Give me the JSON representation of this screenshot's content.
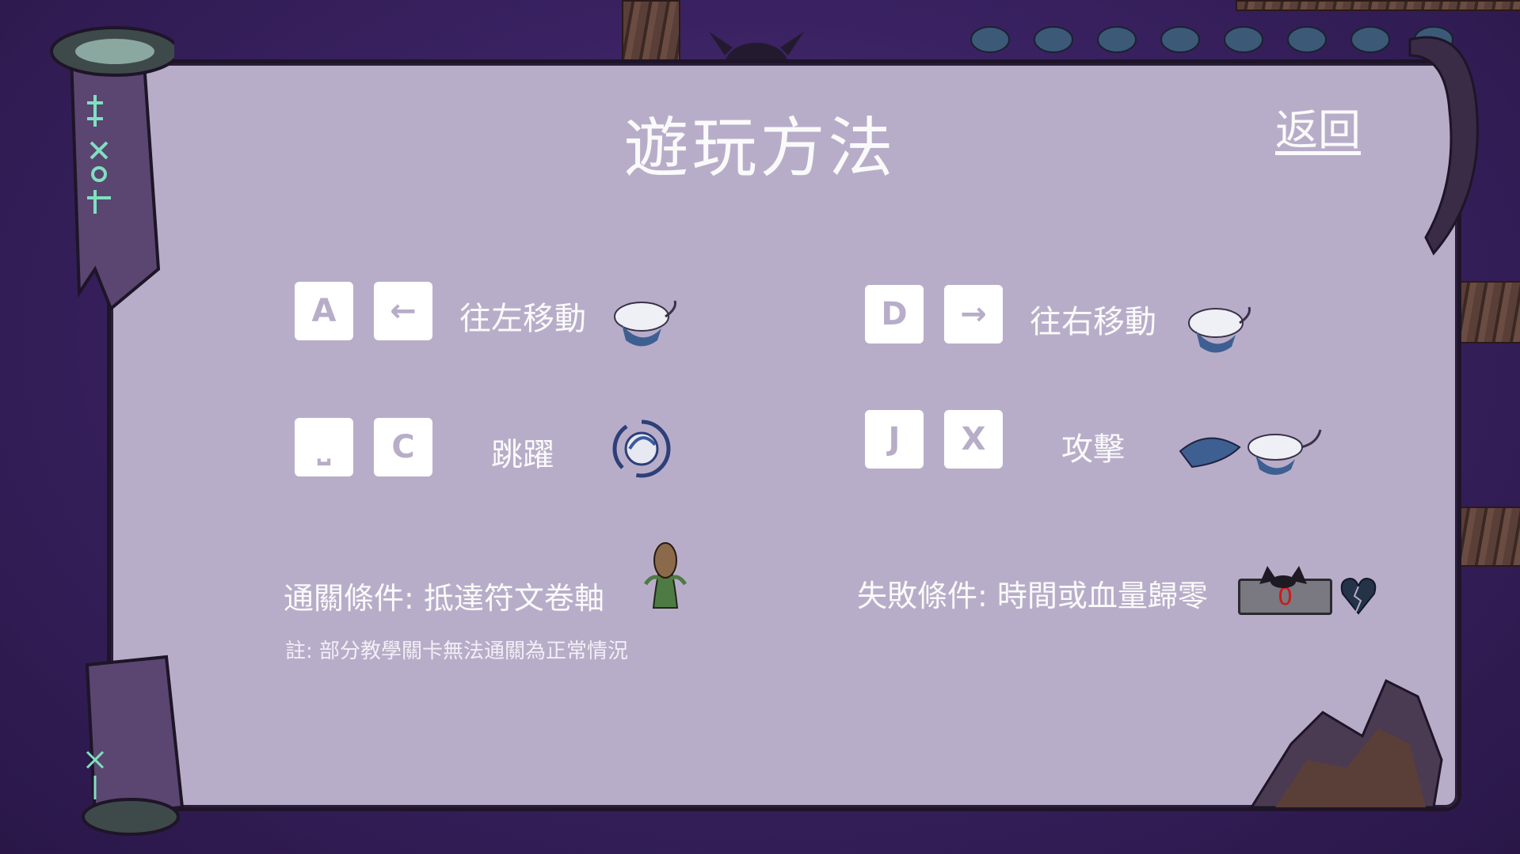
{
  "screen": {
    "title": "遊玩方法",
    "back_label": "返回"
  },
  "controls": {
    "move_left": {
      "keys": [
        "A",
        "←"
      ],
      "label": "往左移動"
    },
    "move_right": {
      "keys": [
        "D",
        "→"
      ],
      "label": "往右移動"
    },
    "jump": {
      "keys": [
        "⎵",
        "C"
      ],
      "label": "跳躍"
    },
    "attack": {
      "keys": [
        "J",
        "X"
      ],
      "label": "攻擊"
    }
  },
  "conditions": {
    "win": "通關條件: 抵達符文卷軸",
    "lose": "失敗條件: 時間或血量歸零",
    "note": "註: 部分教學關卡無法通關為正常情況",
    "timer_value": "0"
  },
  "colors": {
    "panel": "#b8adc9",
    "background": "#3a2262",
    "text": "#fafafa",
    "key_face": "#ffffff",
    "key_glyph": "#b8adc9"
  }
}
